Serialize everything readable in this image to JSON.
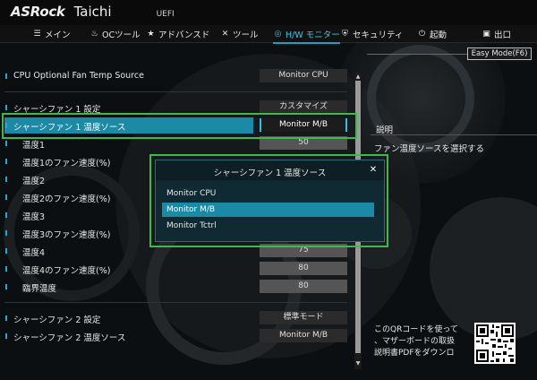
{
  "header": {
    "brand": "ASRock",
    "model": "Taichi",
    "firmware": "UEFI"
  },
  "nav": [
    {
      "label": "メイン",
      "icon": "list-icon",
      "active": false
    },
    {
      "label": "OCツール",
      "icon": "flame-icon",
      "active": false
    },
    {
      "label": "アドバンスド",
      "icon": "star-icon",
      "active": false
    },
    {
      "label": "ツール",
      "icon": "wrench-icon",
      "active": false
    },
    {
      "label": "H/W モニター",
      "icon": "monitor-icon",
      "active": true
    },
    {
      "label": "セキュリティ",
      "icon": "shield-icon",
      "active": false
    },
    {
      "label": "起動",
      "icon": "power-icon",
      "active": false
    },
    {
      "label": "出口",
      "icon": "exit-icon",
      "active": false
    }
  ],
  "easy_mode": "Easy Mode(F6)",
  "settings": [
    {
      "label": "CPU Optional Fan Temp Source",
      "value": "Monitor CPU"
    },
    {
      "label": "シャーシファン 1 設定",
      "value": "カスタマイズ"
    },
    {
      "label": "シャーシファン 1 温度ソース",
      "value": "Monitor M/B"
    },
    {
      "label": "温度1",
      "value": "50"
    },
    {
      "label": "温度1のファン速度(%)",
      "value": ""
    },
    {
      "label": "温度2",
      "value": ""
    },
    {
      "label": "温度2のファン速度(%)",
      "value": ""
    },
    {
      "label": "温度3",
      "value": ""
    },
    {
      "label": "温度3のファン速度(%)",
      "value": ""
    },
    {
      "label": "温度4",
      "value": "75"
    },
    {
      "label": "温度4のファン速度(%)",
      "value": "80"
    },
    {
      "label": "臨界温度",
      "value": "80"
    },
    {
      "label": "シャーシファン 2 設定",
      "value": "標準モード"
    },
    {
      "label": "シャーシファン 2 温度ソース",
      "value": "Monitor M/B"
    }
  ],
  "help": {
    "title": "説明",
    "text": "ファン温度ソースを選択する",
    "qr_lines": [
      "このQRコードを使って",
      "、マザーボードの取扱",
      "説明書PDFをダウンロ"
    ]
  },
  "popup": {
    "title": "シャーシファン 1 温度ソース",
    "options": [
      "Monitor CPU",
      "Monitor M/B",
      "Monitor Tctrl"
    ],
    "selected": "Monitor M/B"
  },
  "colors": {
    "accent": "#1b8aa6",
    "highlight_box": "#3fb94a",
    "active_tab": "#3ec7e6"
  }
}
